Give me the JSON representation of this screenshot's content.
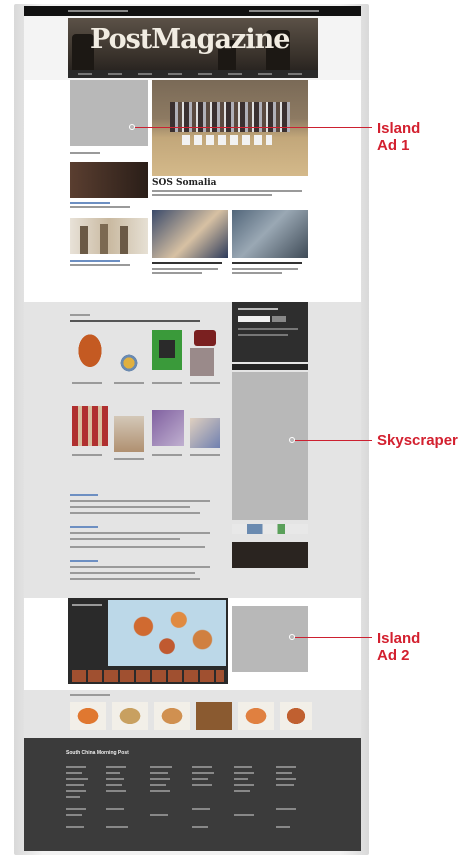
{
  "masthead": {
    "title": "PostMagazine"
  },
  "headline": {
    "title": "SOS Somalia"
  },
  "footer": {
    "title": "South China Morning Post"
  },
  "callouts": [
    {
      "line1": "Island",
      "line2": "Ad 1"
    },
    {
      "line1": "Skyscraper",
      "line2": ""
    },
    {
      "line1": "Island",
      "line2": "Ad 2"
    }
  ],
  "colors": {
    "callout": "#d3202f",
    "ad_placeholder": "#b8b8b8",
    "masthead": "#3a332c",
    "footer": "#3b3b3b"
  }
}
